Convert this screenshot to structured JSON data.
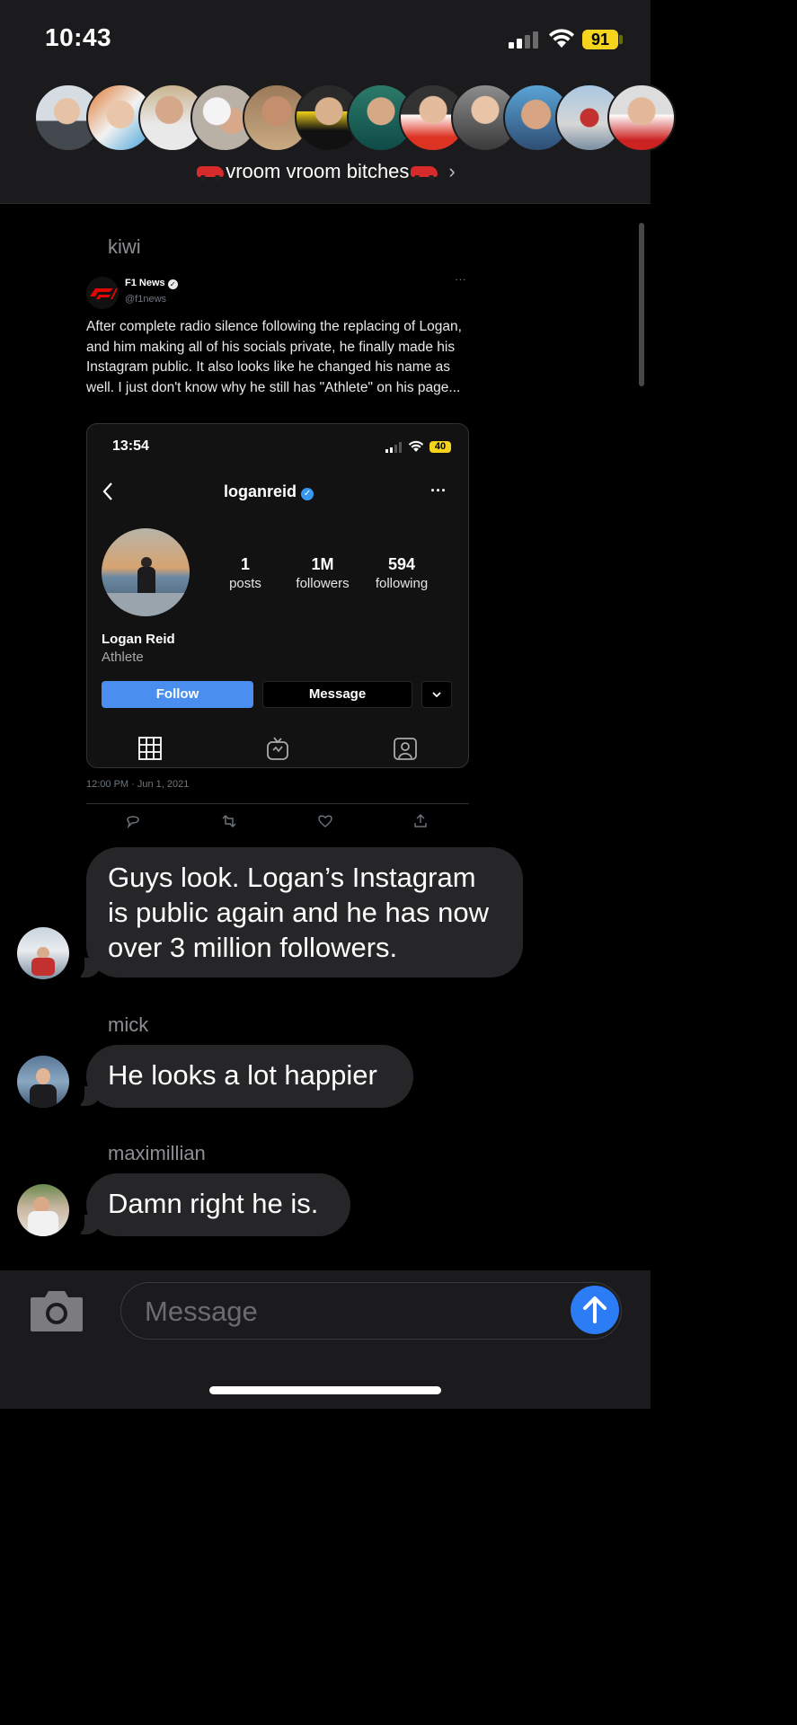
{
  "status_bar": {
    "time": "10:43",
    "battery": "91"
  },
  "group": {
    "name": "vroom vroom bitches"
  },
  "messages": {
    "m1": {
      "sender": "kiwi"
    },
    "m2": {
      "text": "Guys look. Logan’s Instagram is public again and he has now over 3 million followers."
    },
    "m3": {
      "sender": "mick",
      "text": "He looks a lot happier"
    },
    "m4": {
      "sender": "maximillian",
      "text": "Damn right he is."
    }
  },
  "tweet": {
    "account_name": "F1 News",
    "handle": "@f1news",
    "body": "After complete radio silence following the replacing of Logan, and him making all of his socials private, he finally made his Instagram public. It also looks like he changed his name as well. I just don't know why he still has \"Athlete\" on his page...",
    "timestamp": "12:00 PM · Jun 1, 2021",
    "more": "···",
    "ig": {
      "time": "13:54",
      "battery": "40",
      "username": "loganreid",
      "more": "···",
      "posts_count": "1",
      "posts_label": "posts",
      "followers_count": "1M",
      "followers_label": "followers",
      "following_count": "594",
      "following_label": "following",
      "full_name": "Logan Reid",
      "category": "Athlete",
      "follow_label": "Follow",
      "message_label": "Message"
    }
  },
  "composer": {
    "placeholder": "Message"
  },
  "colors": {
    "accent": "#2c7cf6",
    "bubble": "#262628",
    "battery": "#f7d41c",
    "ig_follow": "#4a8ff0"
  }
}
